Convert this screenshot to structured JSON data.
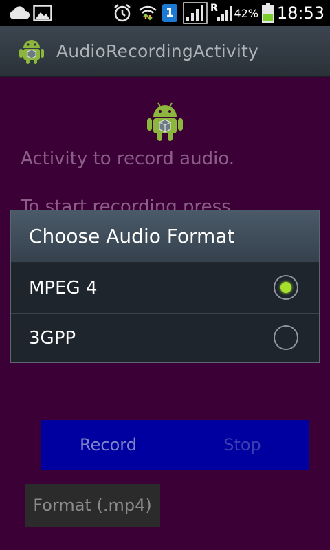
{
  "status_bar": {
    "time": "18:53",
    "battery_percent": "42%",
    "sim_badge": "1",
    "roaming_indicator": "R",
    "icons": [
      "cloud-icon",
      "gallery-icon",
      "alarm-icon",
      "wifi-icon",
      "sim-icon",
      "signal-icon",
      "signal-roaming-icon",
      "battery-icon"
    ]
  },
  "action_bar": {
    "title": "AudioRecordingActivity",
    "icon": "android-app-icon"
  },
  "content": {
    "description": "Activity to record audio.",
    "instruction": "To start recording press",
    "record_label": "Record",
    "stop_label": "Stop",
    "format_label": "Format (.mp4)"
  },
  "dialog": {
    "title": "Choose Audio Format",
    "options": [
      {
        "label": "MPEG 4",
        "selected": true
      },
      {
        "label": "3GPP",
        "selected": false
      }
    ]
  },
  "colors": {
    "content_background": "#3b0036",
    "button_panel": "#0000a0",
    "radio_selected": "#a6e12b"
  }
}
